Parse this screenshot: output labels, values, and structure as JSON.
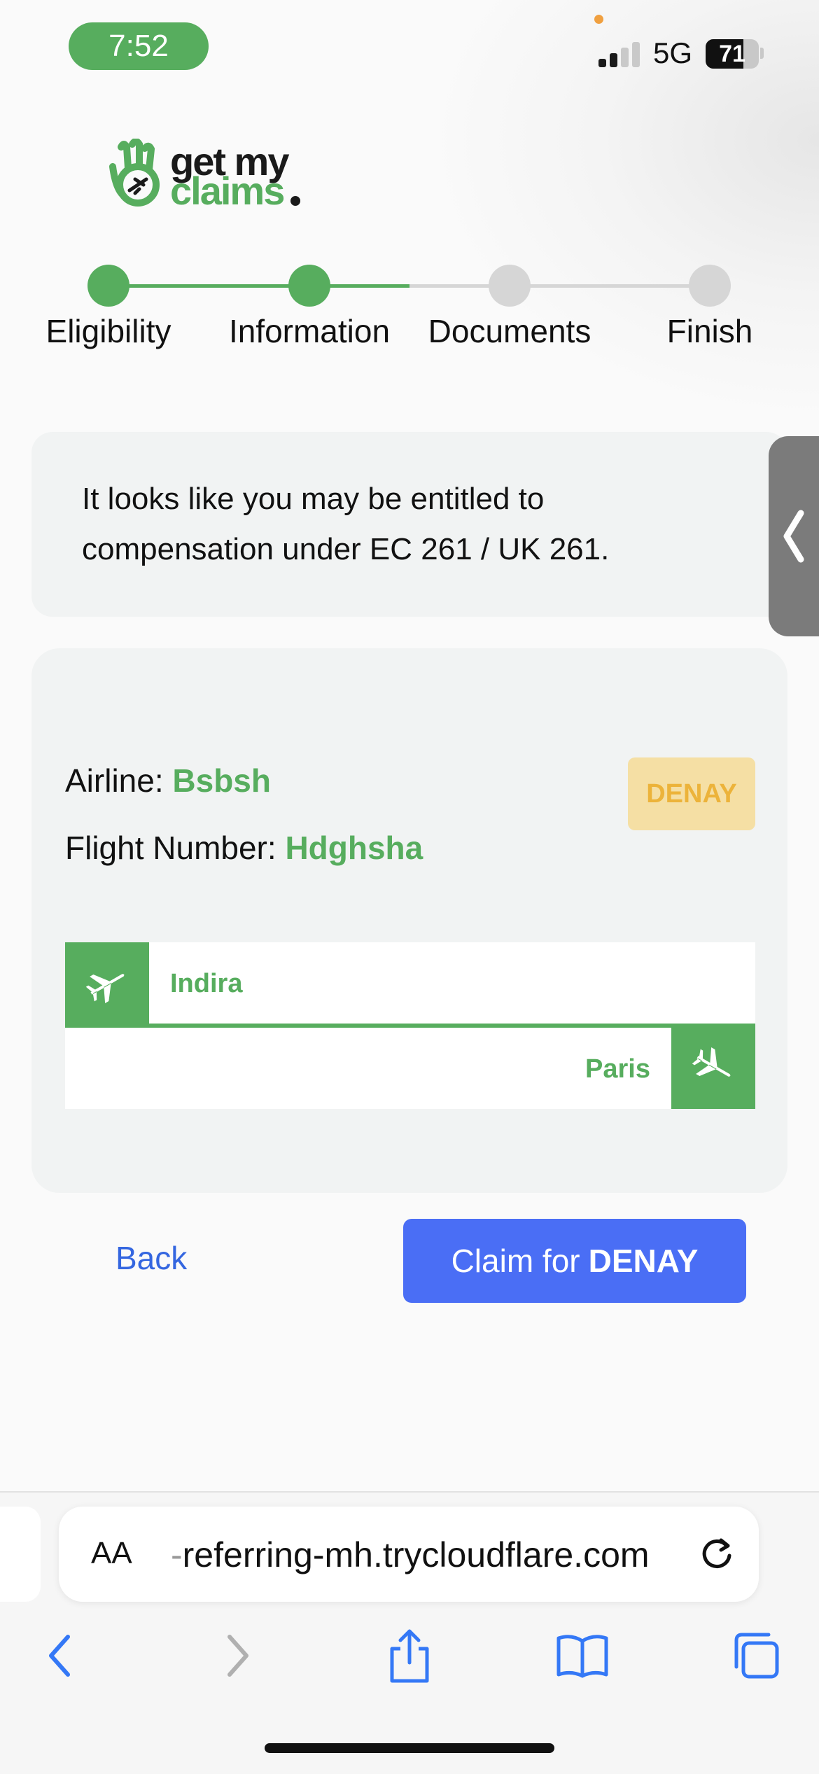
{
  "status_bar": {
    "time": "7:52",
    "network": "5G",
    "battery_percent": "71",
    "battery_level": 0.71,
    "signal_bars_active": 2,
    "signal_bars_total": 4
  },
  "brand": {
    "logo_line1": "get my",
    "logo_line2": "claims",
    "primary_color": "#57ad5e"
  },
  "stepper": {
    "steps": [
      {
        "label": "Eligibility",
        "state": "complete"
      },
      {
        "label": "Information",
        "state": "current"
      },
      {
        "label": "Documents",
        "state": "pending"
      },
      {
        "label": "Finish",
        "state": "pending"
      }
    ],
    "active_color": "#57ad5e",
    "inactive_color": "#d6d6d6"
  },
  "notice": {
    "text": "It looks like you may be entitled to compensation under EC 261 / UK 261."
  },
  "flight": {
    "airline_label": "Airline:",
    "airline_value": "Bsbsh",
    "flight_number_label": "Flight Number:",
    "flight_number_value": "Hdghsha",
    "status_badge": "DENAY",
    "departure": "Indira",
    "arrival": "Paris",
    "departure_icon": "plane-departure-icon",
    "arrival_icon": "plane-arrival-icon"
  },
  "actions": {
    "back_label": "Back",
    "claim_prefix": "Claim for",
    "claim_status": "DENAY",
    "claim_color": "#4a6ef5"
  },
  "browser": {
    "text_size_label": "AA",
    "url_prefix": "-",
    "url": "referring-mh.trycloudflare.com",
    "icons": [
      "back-icon",
      "forward-icon",
      "share-icon",
      "bookmarks-icon",
      "tabs-icon"
    ]
  }
}
